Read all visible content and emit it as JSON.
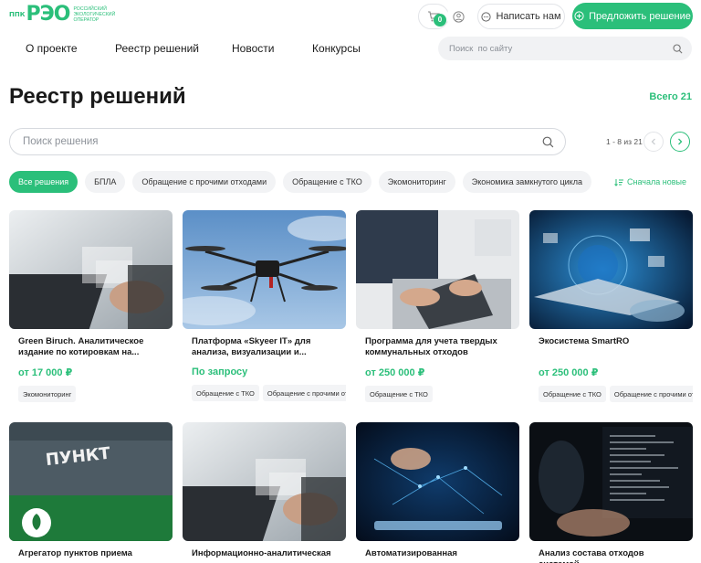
{
  "header": {
    "logo": {
      "mark": "РЭО",
      "prefix": "ППК",
      "text": "Российский экологический оператор"
    },
    "cart_count": "0",
    "write_label": "Написать нам",
    "propose_label": "Предложить решение"
  },
  "nav": {
    "items": [
      "О проекте",
      "Реестр решений",
      "Новости",
      "Конкурсы"
    ],
    "search_placeholder": "Поиск  по сайту"
  },
  "page": {
    "title": "Реестр решений",
    "total_label": "Всего",
    "total_value": "21",
    "search_placeholder": "Поиск решения",
    "pager": "1 - 8 из 21",
    "sort_label": "Сначала новые"
  },
  "filters": [
    "Все решения",
    "БПЛА",
    "Обращение с прочими отходами",
    "Обращение с ТКО",
    "Экомониторинг",
    "Экономика замкнутого цикла"
  ],
  "cards": [
    {
      "title": "Green Biruch. Аналитическое издание по котировкам на...",
      "price": "от 17 000 ₽",
      "tags": [
        "Экомониторинг"
      ],
      "image": "laptop-icon"
    },
    {
      "title": "Платформа «Skyeer IT» для анализа, визуализации и...",
      "price": "По запросу",
      "tags": [
        "Обращение с ТКО",
        "Обращение с прочими отходами"
      ],
      "image": "drone-icon"
    },
    {
      "title": "Программа для учета твердых коммунальных отходов",
      "price": "от 250 000 ₽",
      "tags": [
        "Обращение с ТКО"
      ],
      "image": "laptop-icon"
    },
    {
      "title": "Экосистема SmartRO",
      "price": "от 250 000 ₽",
      "tags": [
        "Обращение с ТКО",
        "Обращение с прочими отходами"
      ],
      "image": "network-icon"
    },
    {
      "title": "Агрегатор пунктов приема",
      "price": "",
      "tags": [],
      "image": "sign-icon"
    },
    {
      "title": "Информационно-аналитическая",
      "price": "",
      "tags": [],
      "image": "laptop-icon"
    },
    {
      "title": "Автоматизированная",
      "price": "",
      "tags": [],
      "image": "tablet-icon"
    },
    {
      "title": "Анализ состава отходов системой",
      "price": "",
      "tags": [],
      "image": "code-icon"
    }
  ],
  "colors": {
    "accent": "#2bbf7a"
  }
}
